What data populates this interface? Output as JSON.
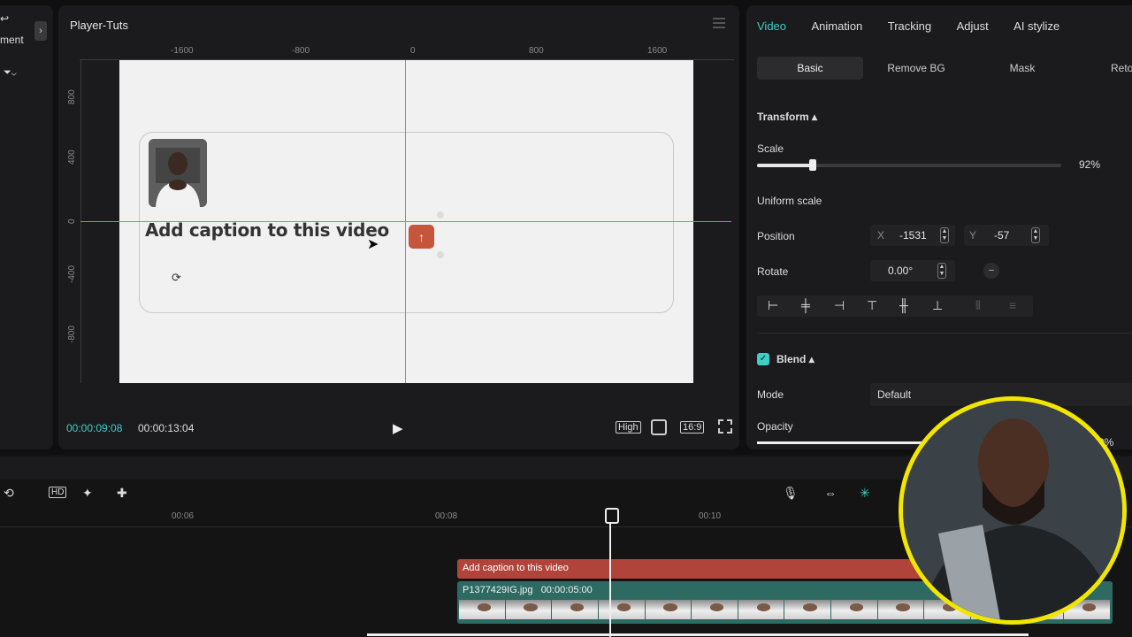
{
  "left_panel": {
    "label": "ment"
  },
  "player": {
    "title": "Player-Tuts",
    "h_ruler": [
      "-1600",
      "-800",
      "0",
      "800",
      "1600"
    ],
    "v_ruler": [
      "800",
      "400",
      "0",
      "-400",
      "-800"
    ],
    "caption_text": "Add caption to this video",
    "current_time": "00:00:09:08",
    "total_time": "00:00:13:04",
    "quality": "High",
    "ratio": "16:9"
  },
  "properties": {
    "tabs": [
      "Video",
      "Animation",
      "Tracking",
      "Adjust",
      "AI stylize"
    ],
    "subtabs": [
      "Basic",
      "Remove BG",
      "Mask",
      "Retou"
    ],
    "transform_label": "Transform",
    "scale_label": "Scale",
    "scale_value": "92%",
    "scale_fraction": 0.92,
    "uniform_scale_label": "Uniform scale",
    "position_label": "Position",
    "x_label": "X",
    "x_value": "-1531",
    "y_label": "Y",
    "y_value": "-57",
    "rotate_label": "Rotate",
    "rotate_value": "0.00°",
    "blend_label": "Blend",
    "mode_label": "Mode",
    "mode_value": "Default",
    "opacity_label": "Opacity",
    "opacity_value": "0%"
  },
  "timeline": {
    "ruler": [
      "00:06",
      "00:08",
      "00:10"
    ],
    "text_clip": "Add caption to this video",
    "video_clip_name": "P1377429IG.jpg",
    "video_clip_duration": "00:00:05:00"
  },
  "colors": {
    "accent": "#3ccfc6",
    "text_clip": "#b0443a",
    "video_clip": "#2c6a62",
    "webcam_ring": "#f2e600"
  }
}
